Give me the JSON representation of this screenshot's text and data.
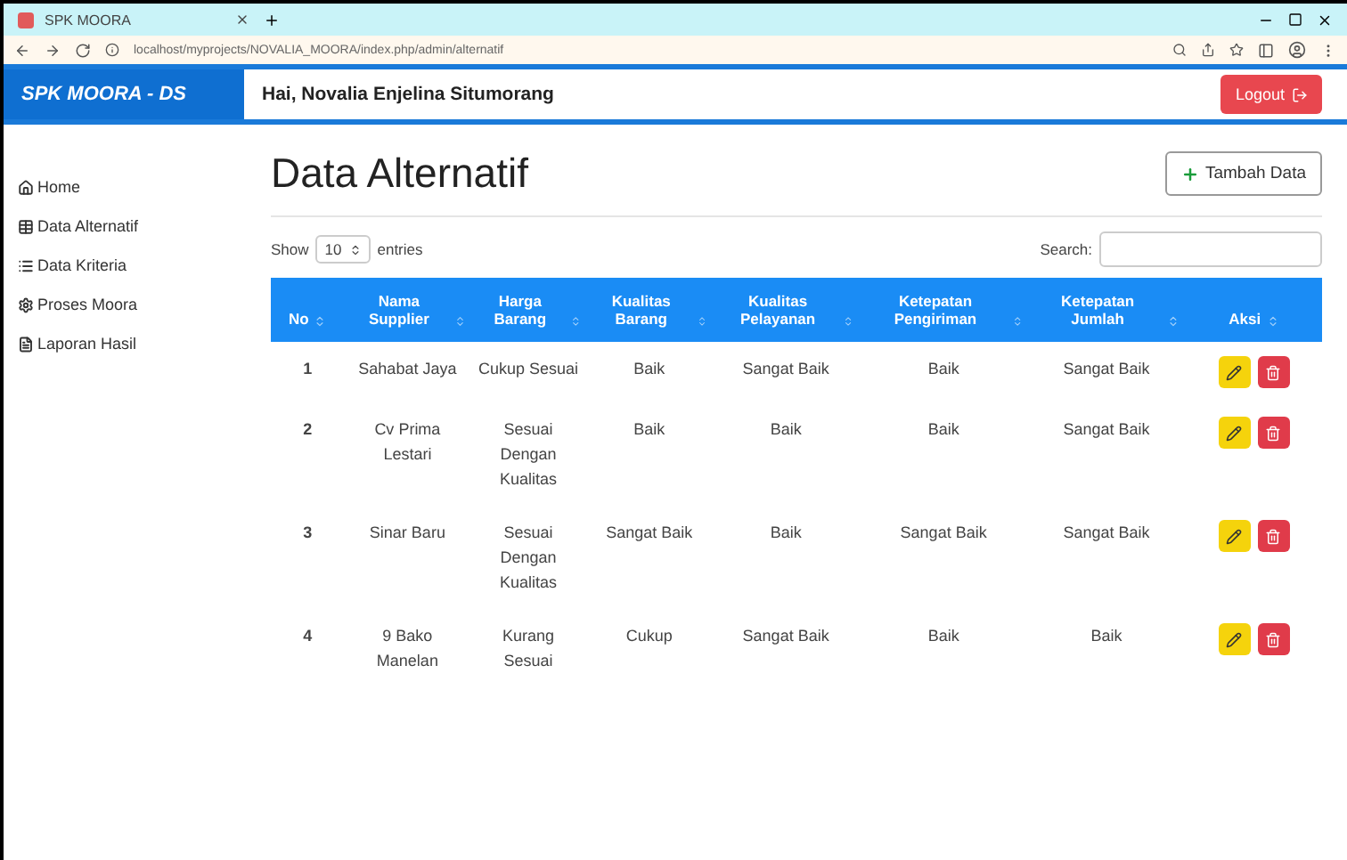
{
  "browser": {
    "tab_title": "SPK MOORA",
    "url": "localhost/myprojects/NOVALIA_MOORA/index.php/admin/alternatif"
  },
  "navbar": {
    "brand": "SPK MOORA - DS",
    "greeting": "Hai, Novalia Enjelina Situmorang",
    "logout": "Logout"
  },
  "sidebar": {
    "items": [
      {
        "label": "Home",
        "kind": "home"
      },
      {
        "label": "Data Alternatif",
        "kind": "table"
      },
      {
        "label": "Data Kriteria",
        "kind": "list"
      },
      {
        "label": "Proses Moora",
        "kind": "cogs"
      },
      {
        "label": "Laporan Hasil",
        "kind": "file"
      }
    ]
  },
  "page": {
    "title": "Data Alternatif",
    "add_button": "Tambah Data",
    "show_label": "Show",
    "page_size": "10",
    "entries_label": "entries",
    "search_label": "Search:"
  },
  "table": {
    "columns": [
      "No",
      "Nama Supplier",
      "Harga Barang",
      "Kualitas Barang",
      "Kualitas Pelayanan",
      "Ketepatan Pengiriman",
      "Ketepatan Jumlah",
      "Aksi"
    ],
    "rows": [
      {
        "cells": [
          "1",
          "Sahabat Jaya",
          "Cukup Sesuai",
          "Baik",
          "Sangat Baik",
          "Baik",
          "Sangat Baik"
        ]
      },
      {
        "cells": [
          "2",
          "Cv Prima Lestari",
          "Sesuai Dengan Kualitas",
          "Baik",
          "Baik",
          "Baik",
          "Sangat Baik"
        ]
      },
      {
        "cells": [
          "3",
          "Sinar Baru",
          "Sesuai Dengan Kualitas",
          "Sangat Baik",
          "Baik",
          "Sangat Baik",
          "Sangat Baik"
        ]
      },
      {
        "cells": [
          "4",
          "9 Bako Manelan",
          "Kurang Sesuai",
          "Cukup",
          "Sangat Baik",
          "Baik",
          "Baik"
        ]
      }
    ]
  }
}
